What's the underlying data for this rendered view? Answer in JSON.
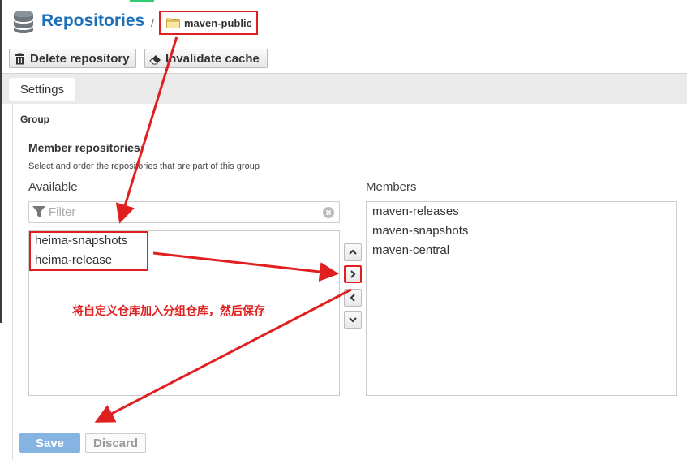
{
  "header": {
    "title": "Repositories",
    "separator": "/",
    "current_repo": "maven-public"
  },
  "toolbar": {
    "delete_label": "Delete repository",
    "invalidate_label": "Invalidate cache"
  },
  "tabs": [
    {
      "label": "Settings"
    }
  ],
  "group": {
    "section_label": "Group",
    "member_title": "Member repositories:",
    "member_description": "Select and order the repositories that are part of this group",
    "available_label": "Available",
    "members_label": "Members",
    "filter_placeholder": "Filter",
    "available_items": [
      "heima-snapshots",
      "heima-release"
    ],
    "member_items": [
      "maven-releases",
      "maven-snapshots",
      "maven-central"
    ]
  },
  "annotation": {
    "text": "将自定义仓库加入分组仓库，然后保存",
    "color": "#e02020"
  },
  "actions": {
    "save_label": "Save",
    "discard_label": "Discard"
  },
  "colors": {
    "title": "#1c6fb9",
    "save_button": "#86b4e2"
  },
  "icons": [
    "database-icon",
    "folder-icon",
    "trash-icon",
    "eraser-icon",
    "filter-icon",
    "clear-icon",
    "chevron-up-icon",
    "chevron-right-icon",
    "chevron-left-icon",
    "chevron-down-icon"
  ]
}
